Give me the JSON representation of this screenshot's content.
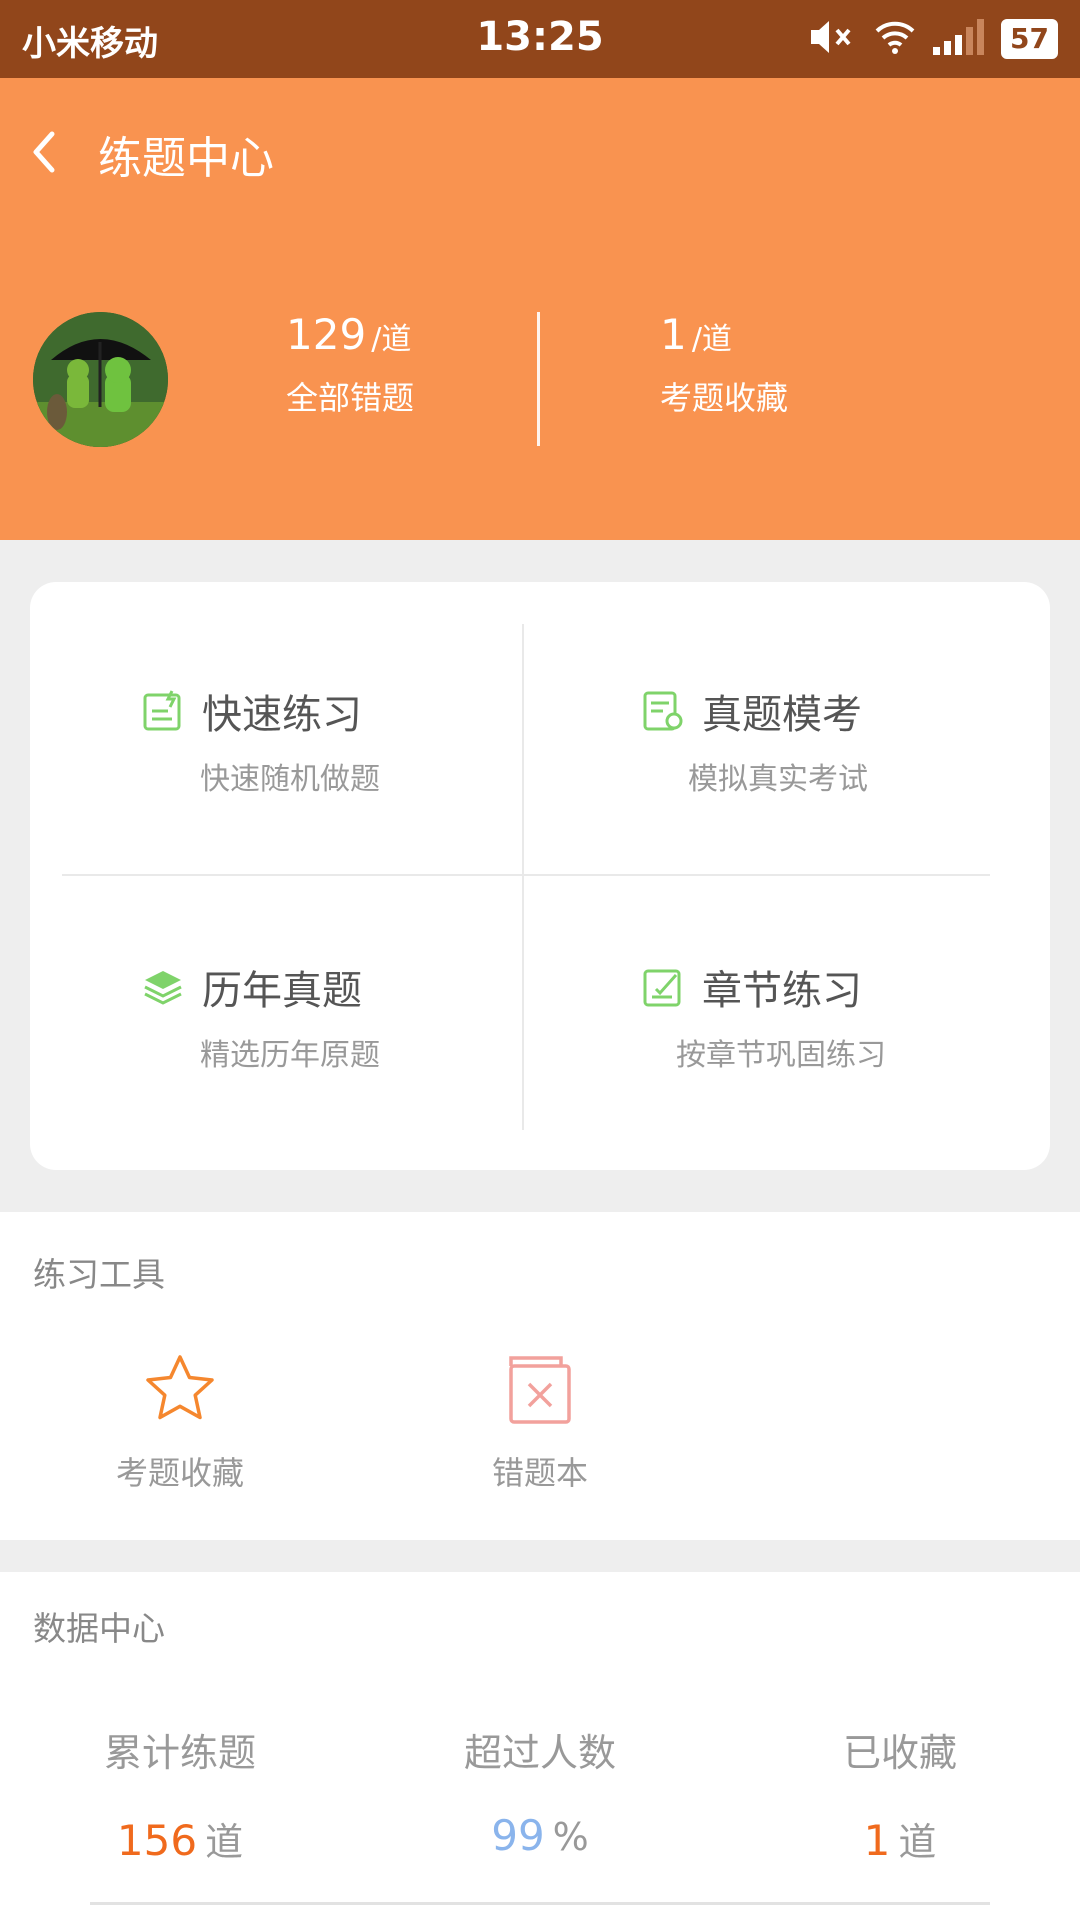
{
  "status_bar": {
    "carrier": "小米移动",
    "time": "13:25",
    "battery": "57"
  },
  "header": {
    "title": "练题中心",
    "wrong_count": "129",
    "wrong_unit": "/道",
    "wrong_label": "全部错题",
    "fav_count": "1",
    "fav_unit": "/道",
    "fav_label": "考题收藏",
    "bg_color": "#f99350"
  },
  "practice": [
    {
      "title": "快速练习",
      "subtitle": "快速随机做题",
      "icon": "quick-practice-icon"
    },
    {
      "title": "真题模考",
      "subtitle": "模拟真实考试",
      "icon": "mock-exam-icon"
    },
    {
      "title": "历年真题",
      "subtitle": "精选历年原题",
      "icon": "layers-icon"
    },
    {
      "title": "章节练习",
      "subtitle": "按章节巩固练习",
      "icon": "chapter-practice-icon"
    }
  ],
  "tools": {
    "title": "练习工具",
    "items": [
      {
        "label": "考题收藏",
        "icon": "star-icon"
      },
      {
        "label": "错题本",
        "icon": "wrong-book-icon"
      }
    ]
  },
  "data_center": {
    "title": "数据中心",
    "metrics": [
      {
        "label": "累计练题",
        "value": "156",
        "unit": "道",
        "color": "#f06a1d"
      },
      {
        "label": "超过人数",
        "value": "99",
        "unit": "%",
        "color": "#8ab4ec"
      },
      {
        "label": "已收藏",
        "value": "1",
        "unit": "道",
        "color": "#f06a1d"
      }
    ]
  }
}
